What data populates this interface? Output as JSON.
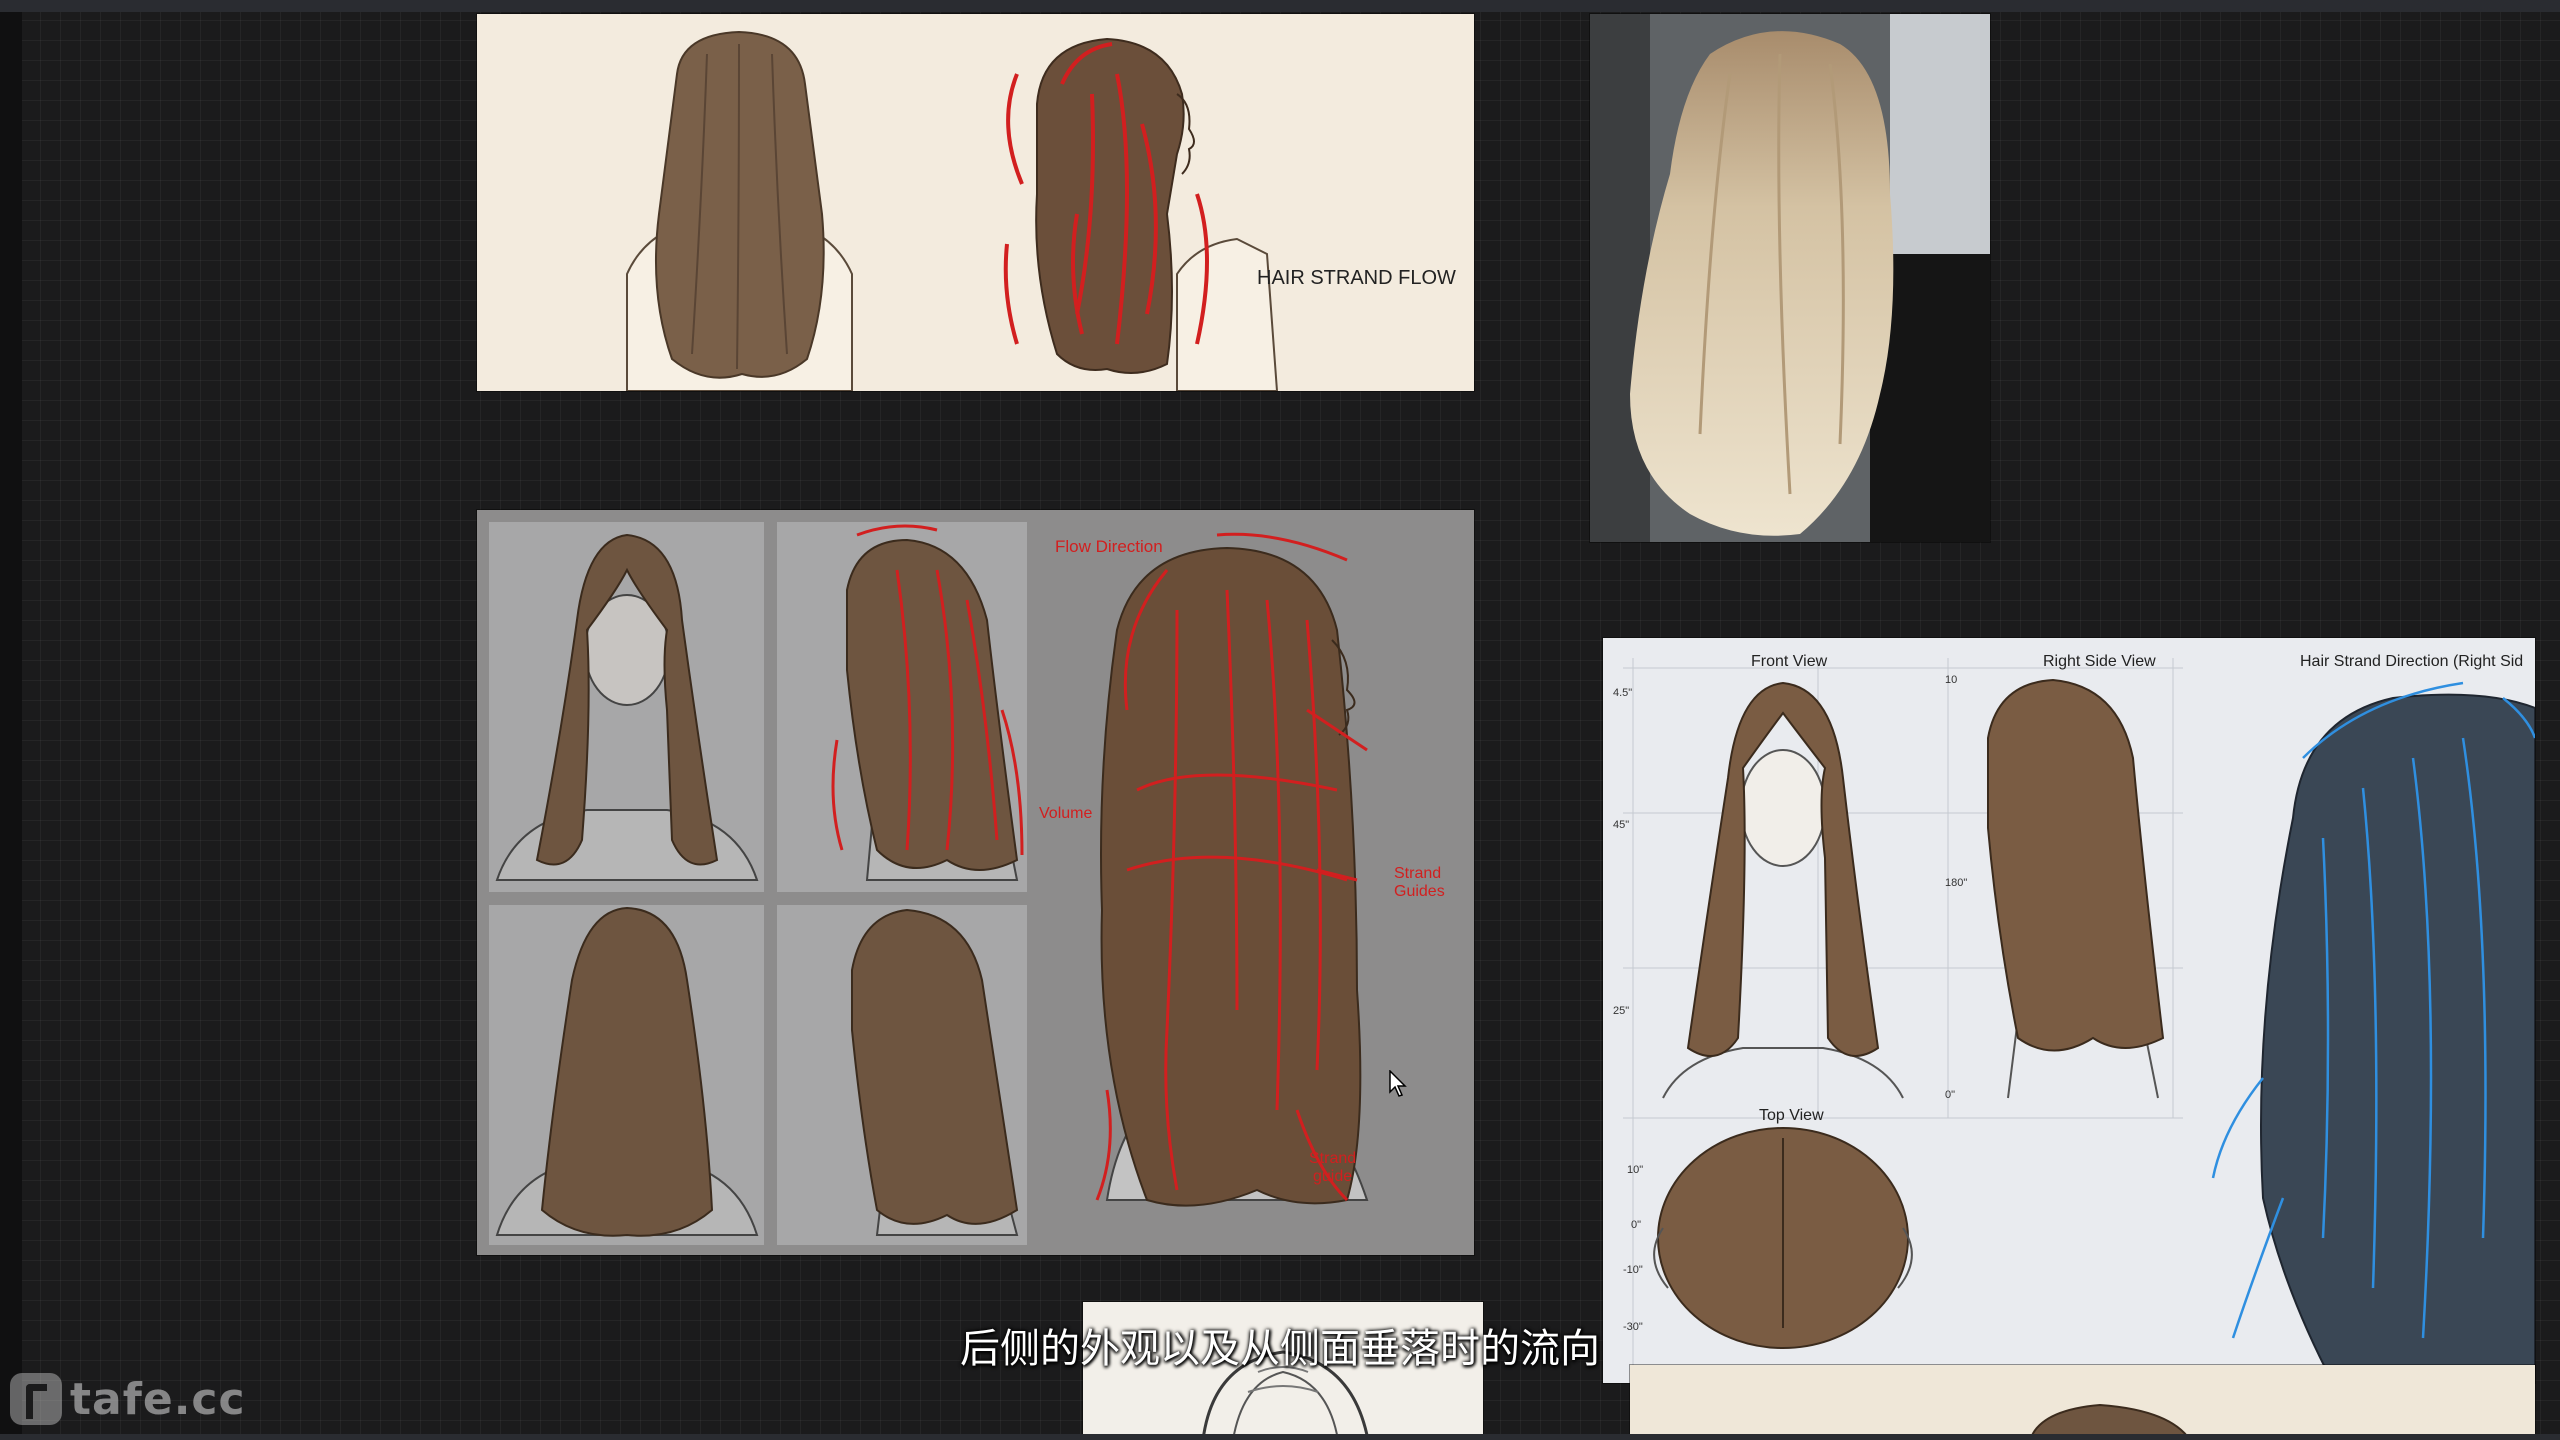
{
  "board": {
    "card1": {
      "label": "HAIR STRAND FLOW"
    },
    "card3": {
      "flow_direction": "Flow Direction",
      "volume": "Volume",
      "strand_guides_1": "Strand",
      "strand_guides_2": "Guides",
      "strand_guide_1": "Strand",
      "strand_guide_2": "guide"
    },
    "card4": {
      "front_view": "Front View",
      "right_side_view": "Right Side View",
      "strand_direction": "Hair Strand Direction (Right Sid",
      "top_view": "Top View",
      "ruler_left": [
        "4.5\"",
        "45\"",
        "25\""
      ],
      "ruler_mid": [
        "10",
        "180\"",
        "0\""
      ],
      "ruler_top_view": [
        "10\"",
        "0\"",
        "-10\"",
        "-30\""
      ]
    }
  },
  "subtitle": "后侧的外观以及从侧面垂落时的流向",
  "watermark": "tafe.cc",
  "colors": {
    "background": "#1b1b1c",
    "hair_brown": "#6e5540",
    "flow_red": "#d21f1f",
    "flow_blue": "#2f8fe0"
  }
}
